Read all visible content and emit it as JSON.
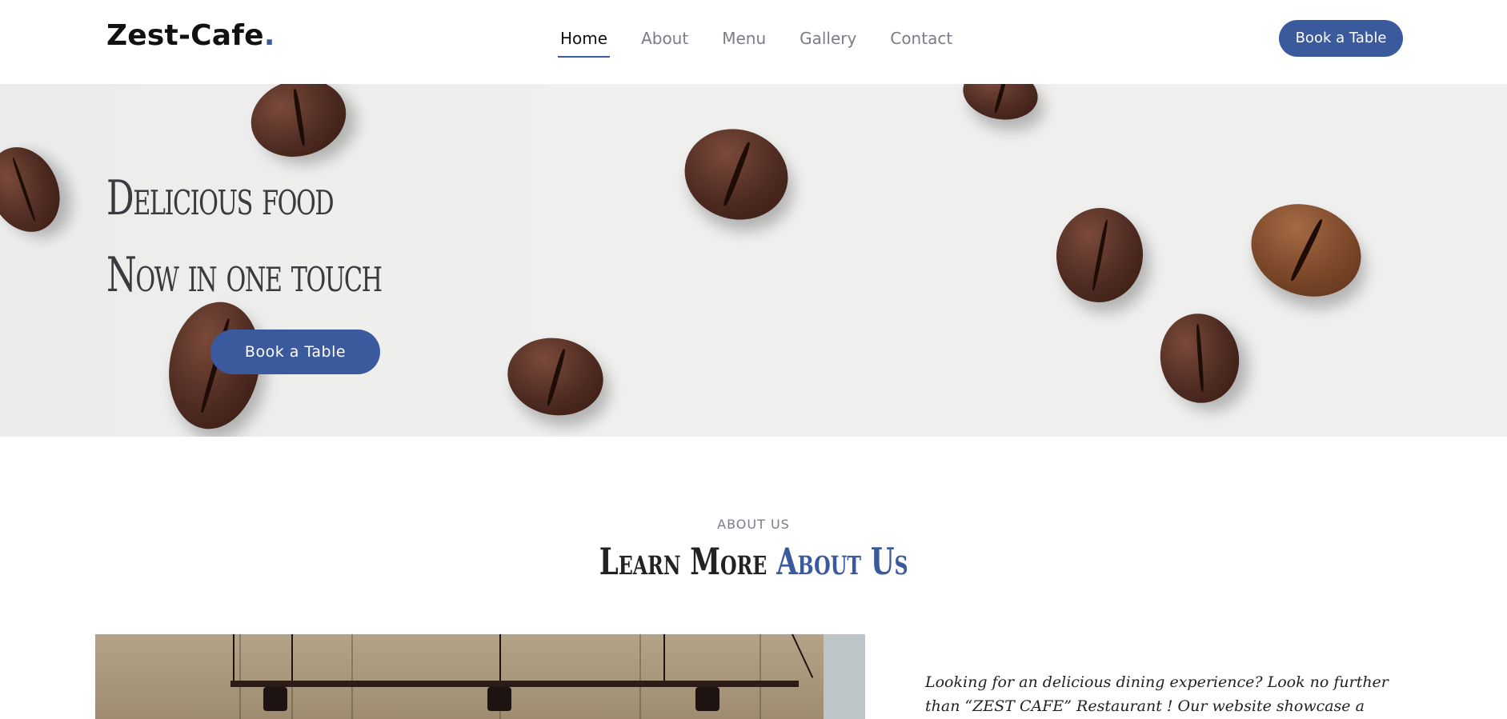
{
  "header": {
    "logo": "Zest-Cafe",
    "logo_dot": ".",
    "nav": [
      "Home",
      "About",
      "Menu",
      "Gallery",
      "Contact"
    ],
    "cta": "Book a Table"
  },
  "hero": {
    "line1": "Delicious food",
    "line2": "Now in one touch",
    "cta": "Book a Table"
  },
  "about": {
    "kicker": "ABOUT US",
    "heading_plain": "Learn More ",
    "heading_accent": "About Us",
    "text": "Looking for an delicious dining experience? Look no further than “ZEST CAFE” Restaurant ! Our website showcase a"
  },
  "colors": {
    "accent": "#3b5a9d",
    "text": "#3a3b3f",
    "nav_inactive": "#7c7c87"
  }
}
